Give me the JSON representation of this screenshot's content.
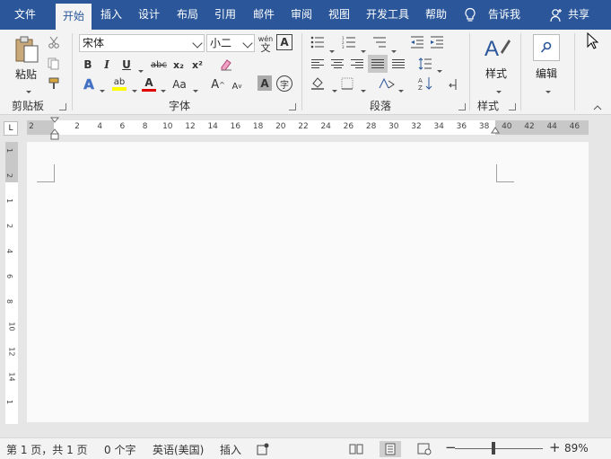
{
  "tabs": [
    {
      "label": "文件",
      "active": false
    },
    {
      "label": "开始",
      "active": true
    },
    {
      "label": "插入",
      "active": false
    },
    {
      "label": "设计",
      "active": false
    },
    {
      "label": "布局",
      "active": false
    },
    {
      "label": "引用",
      "active": false
    },
    {
      "label": "邮件",
      "active": false
    },
    {
      "label": "审阅",
      "active": false
    },
    {
      "label": "视图",
      "active": false
    },
    {
      "label": "开发工具",
      "active": false
    },
    {
      "label": "帮助",
      "active": false
    }
  ],
  "tell_me": "告诉我",
  "share": "共享",
  "clipboard": {
    "paste_label": "粘贴",
    "group_label": "剪贴板"
  },
  "font": {
    "name": "宋体",
    "size": "小二",
    "group_label": "字体",
    "bold": "B",
    "italic": "I",
    "underline": "U",
    "strike": "abc",
    "subscript": "x₂",
    "superscript": "x²",
    "highlight": "ab",
    "font_color": "A",
    "change_case": "Aa",
    "grow": "A",
    "shrink": "A",
    "phonetic": "wén",
    "phonetic_sub": "文",
    "border_char": "A",
    "shade_char": "A",
    "enclose": "字"
  },
  "paragraph": {
    "group_label": "段落"
  },
  "styles": {
    "label": "样式",
    "group_label": "样式"
  },
  "editing": {
    "label": "编辑"
  },
  "ruler": {
    "tab_selector": "L",
    "ticks": [
      "2",
      "2",
      "4",
      "6",
      "8",
      "10",
      "12",
      "14",
      "16",
      "18",
      "20",
      "22",
      "24",
      "26",
      "28",
      "30",
      "32",
      "34",
      "36",
      "38",
      "40",
      "42",
      "44",
      "46"
    ]
  },
  "vruler": {
    "ticks": [
      "1",
      "2",
      "1",
      "2",
      "4",
      "6",
      "8",
      "10",
      "12",
      "14",
      "1"
    ]
  },
  "status": {
    "page": "第 1 页，共 1 页",
    "words": "0 个字",
    "language": "英语(美国)",
    "mode": "插入",
    "zoom": "89%",
    "zoom_value": 89
  },
  "colors": {
    "accent": "#2b579a",
    "highlight": "#ffff00",
    "font_color": "#e00000"
  }
}
